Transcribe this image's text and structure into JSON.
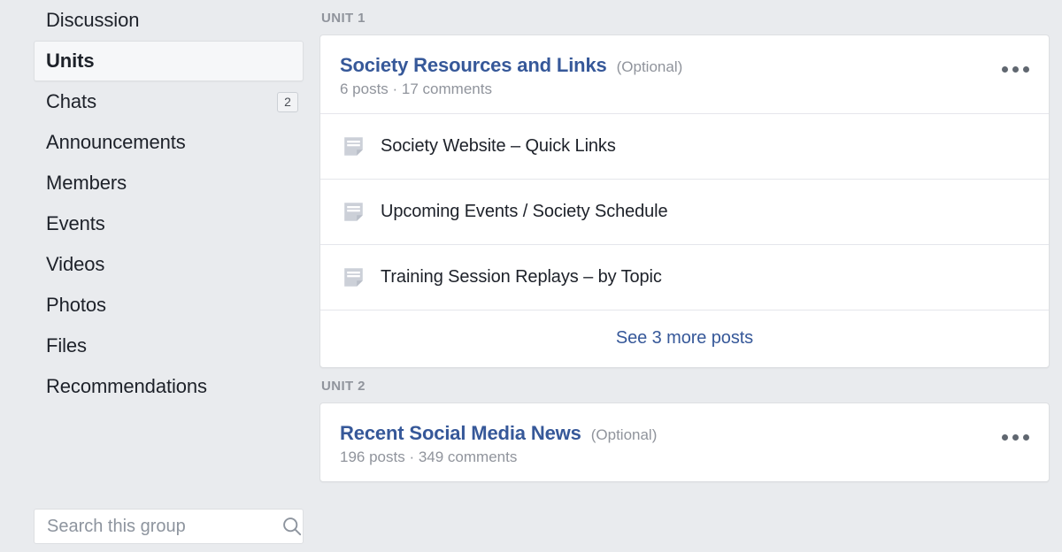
{
  "sidebar": {
    "items": [
      {
        "label": "Discussion",
        "badge": null,
        "active": false
      },
      {
        "label": "Units",
        "badge": null,
        "active": true
      },
      {
        "label": "Chats",
        "badge": "2",
        "active": false
      },
      {
        "label": "Announcements",
        "badge": null,
        "active": false
      },
      {
        "label": "Members",
        "badge": null,
        "active": false
      },
      {
        "label": "Events",
        "badge": null,
        "active": false
      },
      {
        "label": "Videos",
        "badge": null,
        "active": false
      },
      {
        "label": "Photos",
        "badge": null,
        "active": false
      },
      {
        "label": "Files",
        "badge": null,
        "active": false
      },
      {
        "label": "Recommendations",
        "badge": null,
        "active": false
      }
    ],
    "search": {
      "placeholder": "Search this group",
      "value": "",
      "icon": "search-icon"
    }
  },
  "main": {
    "units": [
      {
        "label": "UNIT 1",
        "title": "Society Resources and Links",
        "optional": "(Optional)",
        "meta": "6 posts · 17 comments",
        "menu_icon": "ellipsis-icon",
        "posts": [
          {
            "title": "Society Website – Quick Links",
            "icon": "note-icon"
          },
          {
            "title": "Upcoming Events / Society Schedule",
            "icon": "note-icon"
          },
          {
            "title": "Training Session Replays – by Topic",
            "icon": "note-icon"
          }
        ],
        "see_more": "See 3 more posts"
      },
      {
        "label": "UNIT 2",
        "title": "Recent Social Media News",
        "optional": "(Optional)",
        "meta": "196 posts · 349 comments",
        "menu_icon": "ellipsis-icon",
        "posts": [],
        "see_more": null
      }
    ]
  },
  "colors": {
    "page_background": "#e9ebee",
    "card_background": "#ffffff",
    "link_blue": "#365899",
    "muted_gray": "#90949c",
    "text_dark": "#1d2129",
    "border": "#dddfe2"
  }
}
